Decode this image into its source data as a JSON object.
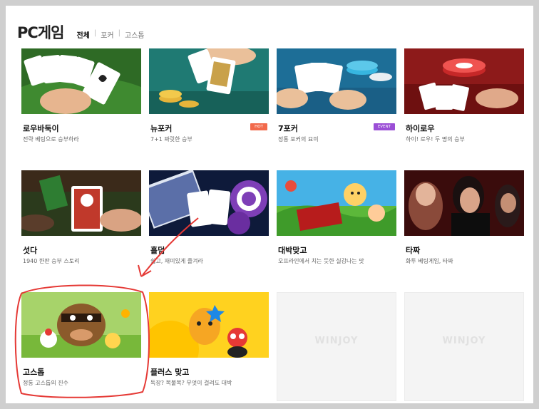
{
  "page": {
    "title": "PC게임"
  },
  "tabs": [
    {
      "label": "전체",
      "active": true
    },
    {
      "label": "포커",
      "active": false
    },
    {
      "label": "고스톱",
      "active": false
    }
  ],
  "games": [
    {
      "name": "로우바둑이",
      "desc": "전략 베팅으로 승부하라"
    },
    {
      "name": "뉴포커",
      "desc": "7+1 짜릿한 승부",
      "badge": "HOT",
      "badge_color": "#f26a4b"
    },
    {
      "name": "7포커",
      "desc": "정통 포커의 묘미",
      "badge": "EVENT",
      "badge_color": "#9b4fd6"
    },
    {
      "name": "하이로우",
      "desc": "하이! 로우! 두 명의 승부"
    },
    {
      "name": "섯다",
      "desc": "1940 한판 승부 스토리"
    },
    {
      "name": "홀덤",
      "desc": "쉽고, 재미있게 즐겨라"
    },
    {
      "name": "대박맞고",
      "desc": "오프라인에서 치는 듯한 실감나는 맛"
    },
    {
      "name": "타짜",
      "desc": "화투 베팅게임, 타짜"
    },
    {
      "name": "고스톱",
      "desc": "정통 고스톱의 진수"
    },
    {
      "name": "플러스 맞고",
      "desc": "독장? 복불복? 무엇이 걸려도 대박"
    }
  ],
  "placeholders": [
    {
      "watermark": "WINJOY"
    },
    {
      "watermark": "WINJOY"
    }
  ],
  "annotation_color": "#e53935"
}
